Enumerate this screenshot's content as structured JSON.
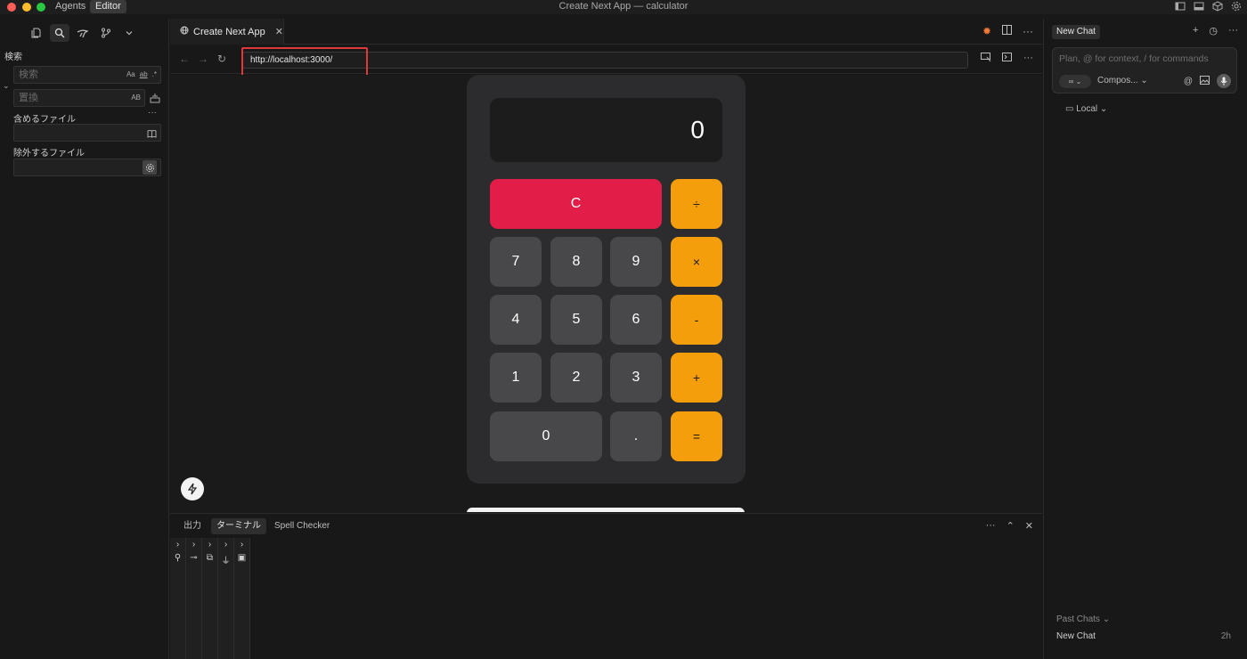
{
  "titlebar": {
    "modes": {
      "agents": "Agents",
      "editor": "Editor"
    },
    "window_title": "Create Next App — calculator"
  },
  "sidebar": {
    "section_title": "検索",
    "search_placeholder": "検索",
    "search_opts": {
      "case": "Aa",
      "word": "ab",
      "regex": ".*"
    },
    "replace_placeholder": "置換",
    "replace_opt": "AB",
    "include_label": "含めるファイル",
    "exclude_label": "除外するファイル",
    "more": "···"
  },
  "editor": {
    "tab_title": "Create Next App",
    "url": "http://localhost:3000/"
  },
  "calculator": {
    "display": "0",
    "keys": {
      "clear": "C",
      "divide": "÷",
      "multiply": "×",
      "minus": "-",
      "plus": "+",
      "equals": "=",
      "seven": "7",
      "eight": "8",
      "nine": "9",
      "four": "4",
      "five": "5",
      "six": "6",
      "one": "1",
      "two": "2",
      "three": "3",
      "zero": "0",
      "dot": "."
    }
  },
  "panel": {
    "tabs": {
      "output": "出力",
      "terminal": "ターミナル",
      "spell": "Spell Checker"
    },
    "more": "···"
  },
  "chat": {
    "tab": "New Chat",
    "placeholder": "Plan, @ for context, / for commands",
    "mode_icon": "∞",
    "model": "Compos...",
    "location": "Local",
    "past_label": "Past Chats",
    "past_items": [
      {
        "title": "New Chat",
        "time": "2h"
      }
    ]
  },
  "colors": {
    "accent_orange": "#f59e0b",
    "clear_red": "#e11d48",
    "key_gray": "#48484a",
    "highlight_red": "#e0393b"
  }
}
